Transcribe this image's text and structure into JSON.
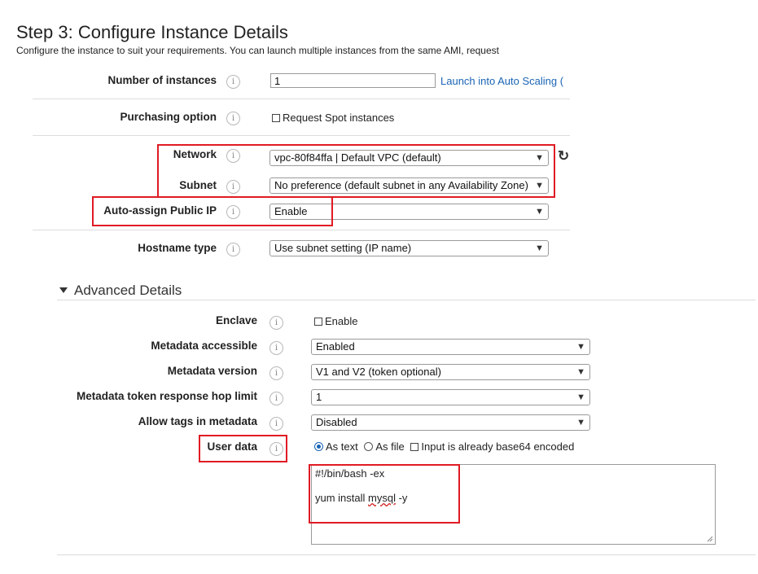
{
  "header": {
    "title": "Step 3: Configure Instance Details",
    "subtitle": "Configure the instance to suit your requirements. You can launch multiple instances from the same AMI, request"
  },
  "info_glyph": "i",
  "fields": {
    "num_instances": {
      "label": "Number of instances",
      "value": "1",
      "link": "Launch into Auto Scaling ("
    },
    "purchasing": {
      "label": "Purchasing option",
      "checkbox_label": "Request Spot instances",
      "checked": false
    },
    "network": {
      "label": "Network",
      "value": "vpc-80f84ffa | Default VPC (default)"
    },
    "subnet": {
      "label": "Subnet",
      "value": "No preference (default subnet in any Availability Zone)"
    },
    "auto_ip": {
      "label": "Auto-assign Public IP",
      "value": "Enable"
    },
    "hostname": {
      "label": "Hostname type",
      "value": "Use subnet setting (IP name)"
    }
  },
  "advanced": {
    "title": "Advanced Details",
    "enclave": {
      "label": "Enclave",
      "checkbox_label": "Enable",
      "checked": false
    },
    "metadata_accessible": {
      "label": "Metadata accessible",
      "value": "Enabled"
    },
    "metadata_version": {
      "label": "Metadata version",
      "value": "V1 and V2 (token optional)"
    },
    "hop_limit": {
      "label": "Metadata token response hop limit",
      "value": "1"
    },
    "allow_tags": {
      "label": "Allow tags in metadata",
      "value": "Disabled"
    },
    "user_data": {
      "label": "User data",
      "options": [
        "As text",
        "As file",
        "Input is already base64 encoded"
      ],
      "selected": "As text",
      "line1": "#!/bin/bash -ex",
      "line2_prefix": "yum install ",
      "line2_word": "mysql",
      "line2_suffix": " -y"
    }
  },
  "icons": {
    "info": "info-icon",
    "dropdown": "dropdown-arrow-icon",
    "refresh": "refresh-icon",
    "collapse": "triangle-down-icon"
  },
  "colors": {
    "annotation": "#e01b24",
    "link": "#1a64b4"
  }
}
